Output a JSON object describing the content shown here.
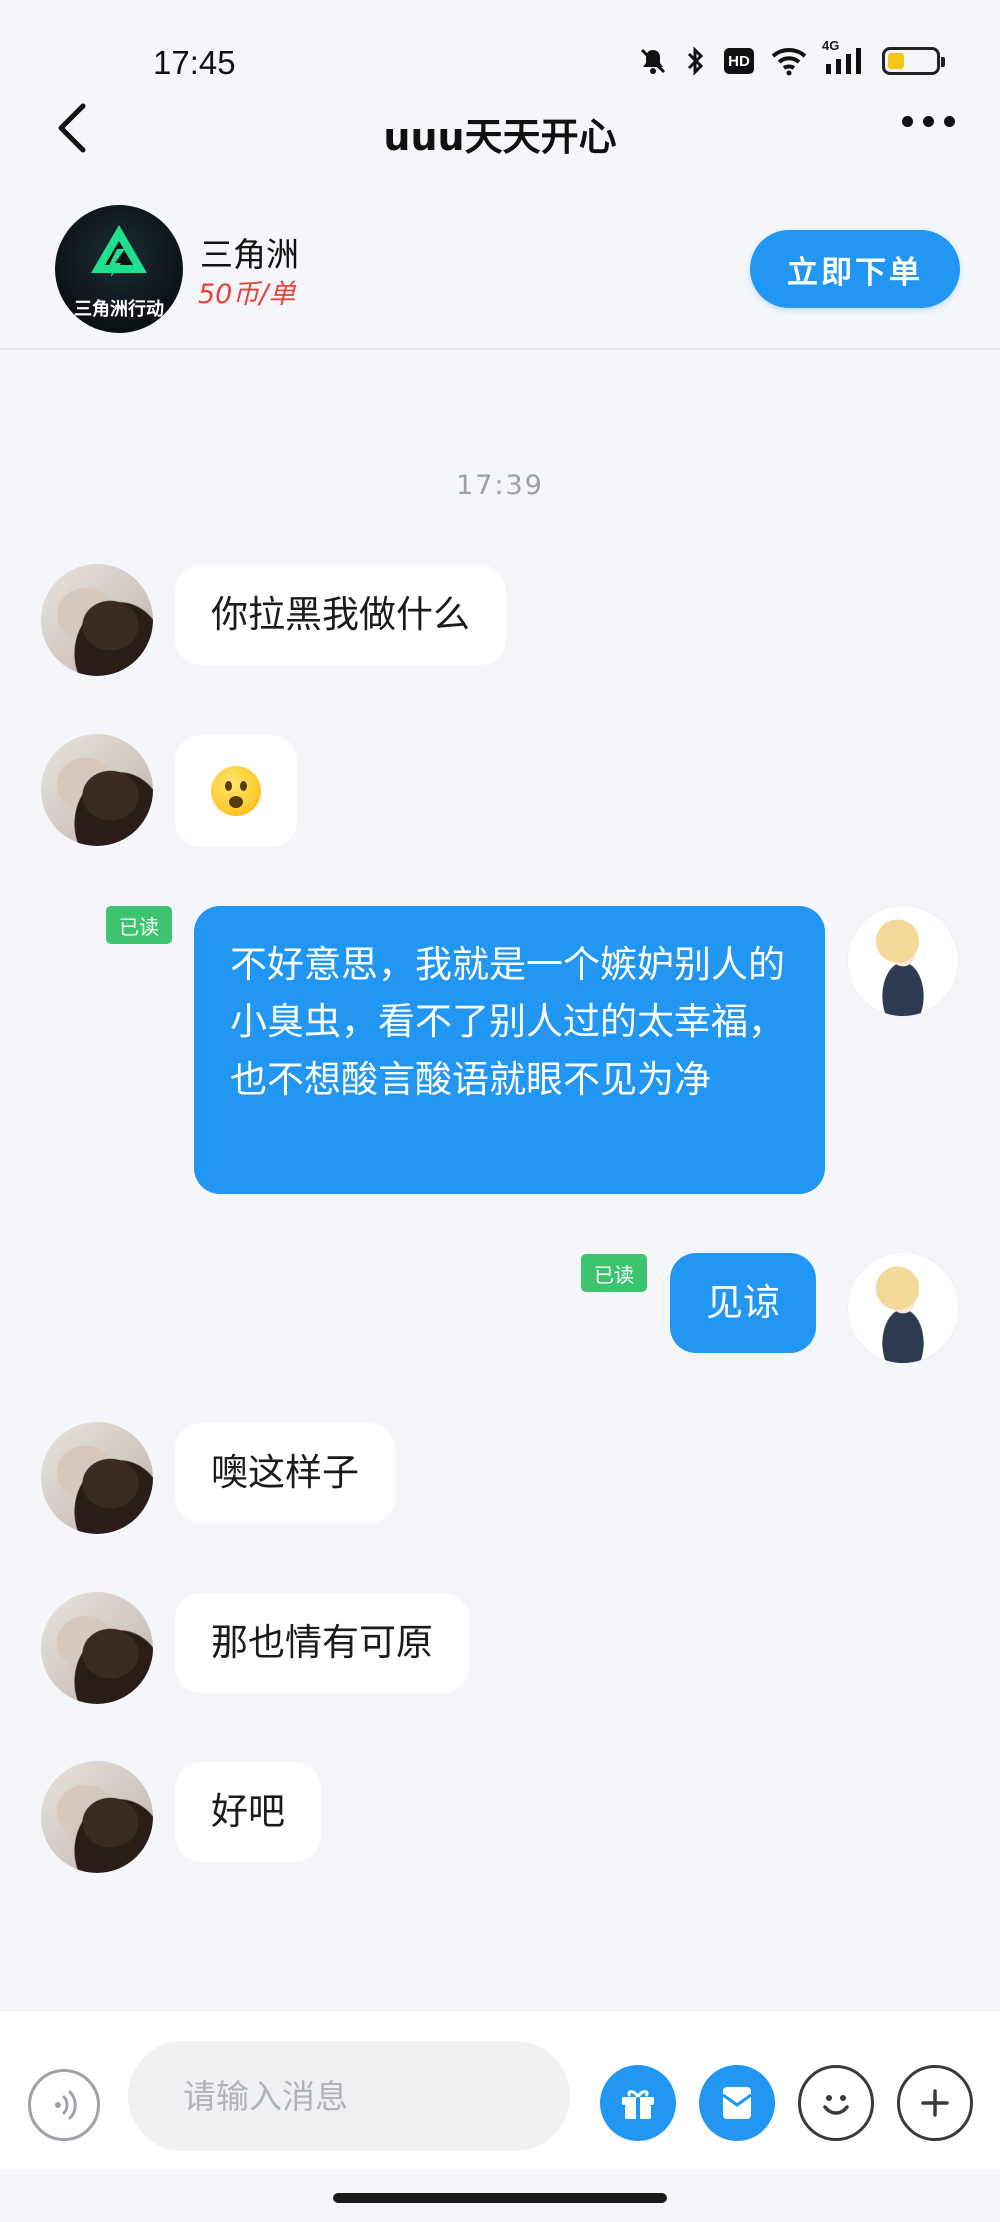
{
  "status_bar": {
    "time": "17:45",
    "network": "4G",
    "hd": "HD",
    "battery_level": 0.35,
    "battery_color": "#f5c518",
    "icons": [
      "mute-bell-icon",
      "bluetooth-icon",
      "hd-icon",
      "wifi-icon",
      "signal-icon",
      "battery-icon"
    ]
  },
  "header": {
    "title": "uuu天天开心"
  },
  "product": {
    "logo_text": "三角洲行动",
    "name": "三角洲",
    "price": "50币/单",
    "order_button": "立即下单"
  },
  "chat": {
    "timestamp": "17:39",
    "read_label": "已读",
    "messages": [
      {
        "side": "in",
        "text": "你拉黑我做什么"
      },
      {
        "side": "in",
        "emoji": "frowning-face"
      },
      {
        "side": "out",
        "text": "不好意思，我就是一个嫉妒别人的小臭虫，看不了别人过的太幸福，也不想酸言酸语就眼不见为净",
        "read": true
      },
      {
        "side": "out",
        "text": "见谅",
        "read": true
      },
      {
        "side": "in",
        "text": "噢这样子"
      },
      {
        "side": "in",
        "text": "那也情有可原"
      },
      {
        "side": "in",
        "text": "好吧"
      }
    ]
  },
  "input_bar": {
    "placeholder": "请输入消息"
  },
  "colors": {
    "accent": "#2196f3",
    "price": "#e8433a",
    "read_badge": "#3cc46f",
    "background": "#f4f6f9"
  }
}
